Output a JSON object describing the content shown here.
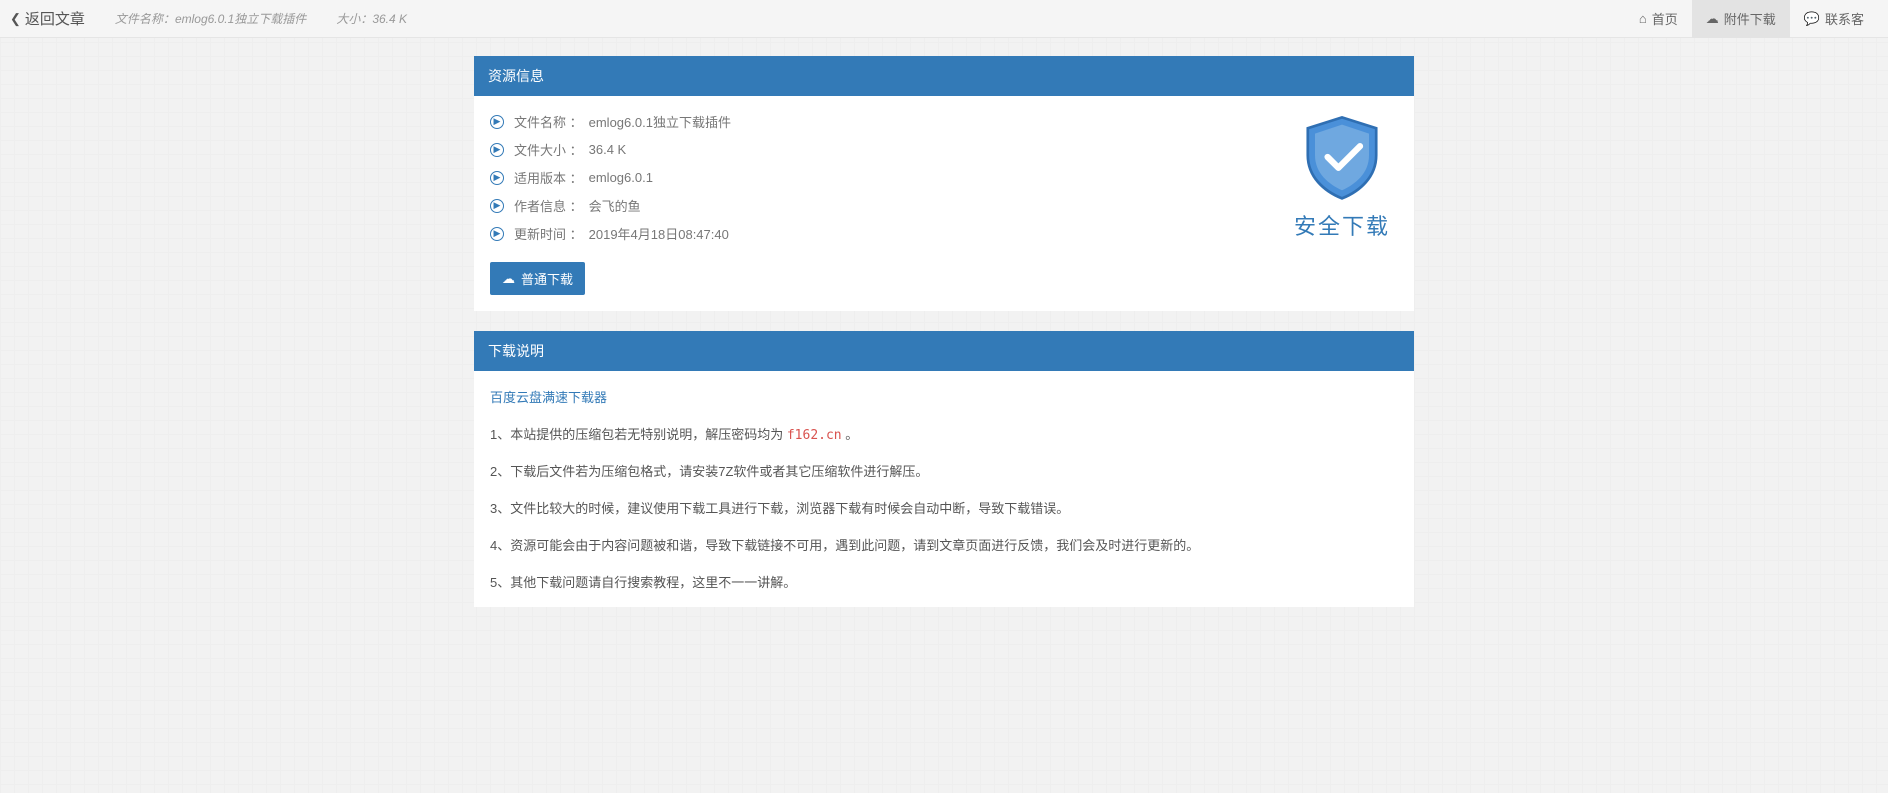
{
  "topbar": {
    "back": "返回文章",
    "filename_label": "文件名称：",
    "filename": "emlog6.0.1独立下载插件",
    "size_label": "大小：",
    "size": "36.4 K",
    "nav": {
      "home": "首页",
      "attachment": "附件下载",
      "contact": "联系客"
    }
  },
  "resource": {
    "header": "资源信息",
    "rows": {
      "filename_label": "文件名称 ：",
      "filename": "emlog6.0.1独立下载插件",
      "filesize_label": "文件大小 ：",
      "filesize": "36.4 K",
      "version_label": "适用版本 ：",
      "version": "emlog6.0.1",
      "author_label": "作者信息 ：",
      "author": "会飞的鱼",
      "updated_label": "更新时间 ：",
      "updated": "2019年4月18日08:47:40"
    },
    "download_btn": "普通下载",
    "shield_caption": "安全下载"
  },
  "instructions": {
    "header": "下载说明",
    "tool_link": "百度云盘满速下载器",
    "line1_a": "1、本站提供的压缩包若无特别说明，解压密码均为 ",
    "line1_pw": "f162.cn",
    "line1_b": " 。",
    "line2": "2、下载后文件若为压缩包格式，请安装7Z软件或者其它压缩软件进行解压。",
    "line3": "3、文件比较大的时候，建议使用下载工具进行下载，浏览器下载有时候会自动中断，导致下载错误。",
    "line4": "4、资源可能会由于内容问题被和谐，导致下载链接不可用，遇到此问题，请到文章页面进行反馈，我们会及时进行更新的。",
    "line5": "5、其他下载问题请自行搜索教程，这里不一一讲解。"
  }
}
